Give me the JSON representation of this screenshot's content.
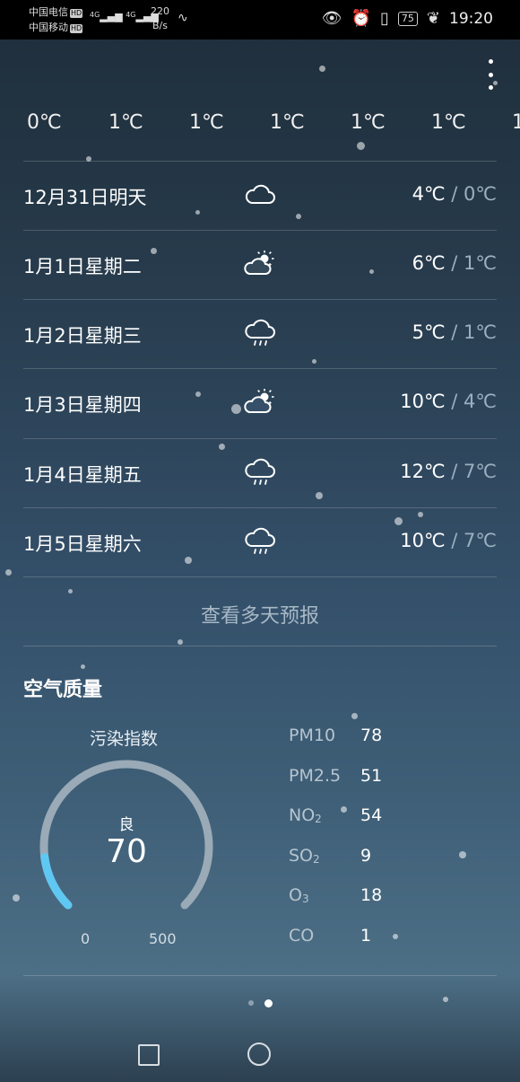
{
  "status_bar": {
    "carrier_1": "中国电信",
    "carrier_2": "中国移动",
    "hd_badge": "HD",
    "network_1": "4G",
    "network_2": "4G",
    "speed_value": "220",
    "speed_unit": "B/s",
    "battery": "75",
    "time": "19:20",
    "icons": [
      "eye-icon",
      "alarm-icon",
      "vibrate-icon",
      "battery-icon",
      "leaf-icon"
    ]
  },
  "hourly_temps": [
    "0℃",
    "1℃",
    "1℃",
    "1℃",
    "1℃",
    "1℃",
    "1"
  ],
  "daily": [
    {
      "label": "12月31日明天",
      "icon": "cloudy-icon",
      "high": "4℃",
      "low": "0℃"
    },
    {
      "label": "1月1日星期二",
      "icon": "partly-cloudy-icon",
      "high": "6℃",
      "low": "1℃"
    },
    {
      "label": "1月2日星期三",
      "icon": "rain-icon",
      "high": "5℃",
      "low": "1℃"
    },
    {
      "label": "1月3日星期四",
      "icon": "partly-cloudy-icon",
      "high": "10℃",
      "low": "4℃"
    },
    {
      "label": "1月4日星期五",
      "icon": "rain-icon",
      "high": "12℃",
      "low": "7℃"
    },
    {
      "label": "1月5日星期六",
      "icon": "rain-icon",
      "high": "10℃",
      "low": "7℃"
    }
  ],
  "temp_separator": " / ",
  "more_forecast": "查看多天预报",
  "air_quality": {
    "title": "空气质量",
    "index_label": "污染指数",
    "grade": "良",
    "value": "70",
    "gauge_min": "0",
    "gauge_max": "500",
    "gauge_fraction": 0.14,
    "pollutants": [
      {
        "name": "PM10",
        "sub": "",
        "value": "78"
      },
      {
        "name": "PM2.5",
        "sub": "",
        "value": "51"
      },
      {
        "name": "NO",
        "sub": "2",
        "value": "54"
      },
      {
        "name": "SO",
        "sub": "2",
        "value": "9"
      },
      {
        "name": "O",
        "sub": "3",
        "value": "18"
      },
      {
        "name": "CO",
        "sub": "",
        "value": "1"
      }
    ]
  },
  "colors": {
    "gauge_track": "#9aaab6",
    "gauge_fill": "#5fc8f2"
  },
  "pager": {
    "count": 2,
    "active": 1
  }
}
